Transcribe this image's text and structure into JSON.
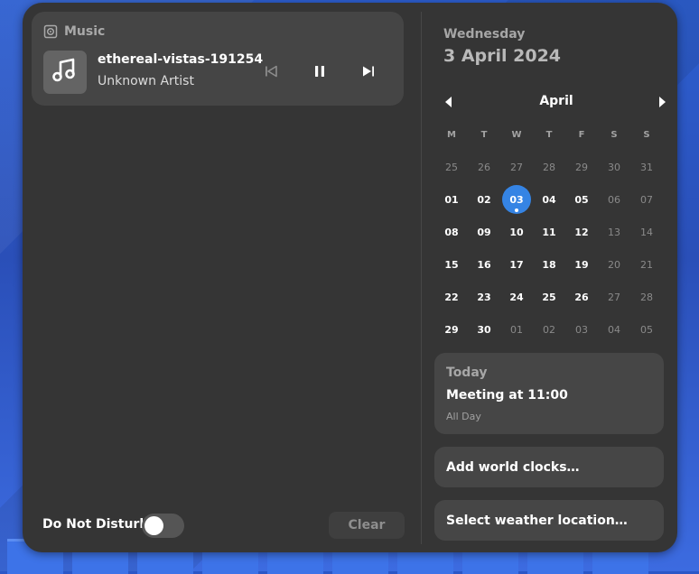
{
  "media": {
    "app_name": "Music",
    "track_title": "ethereal-vistas-191254",
    "artist": "Unknown Artist"
  },
  "notifications": {
    "dnd_label": "Do Not Disturb",
    "dnd_enabled": false,
    "clear_label": "Clear"
  },
  "calendar": {
    "weekday": "Wednesday",
    "date": "3 April 2024",
    "month": "April",
    "days_of_week": [
      "M",
      "T",
      "W",
      "T",
      "F",
      "S",
      "S"
    ],
    "weeks": [
      [
        "25",
        "26",
        "27",
        "28",
        "29",
        "30",
        "31"
      ],
      [
        "01",
        "02",
        "03",
        "04",
        "05",
        "06",
        "07"
      ],
      [
        "08",
        "09",
        "10",
        "11",
        "12",
        "13",
        "14"
      ],
      [
        "15",
        "16",
        "17",
        "18",
        "19",
        "20",
        "21"
      ],
      [
        "22",
        "23",
        "24",
        "25",
        "26",
        "27",
        "28"
      ],
      [
        "29",
        "30",
        "01",
        "02",
        "03",
        "04",
        "05"
      ]
    ],
    "today": "03"
  },
  "events": {
    "heading": "Today",
    "items": [
      {
        "title": "Meeting at 11:00",
        "time": "All Day"
      }
    ]
  },
  "world_clocks_label": "Add world clocks…",
  "weather_label": "Select weather location…",
  "colors": {
    "accent": "#3584e4",
    "panel": "#353535",
    "card": "#464646"
  }
}
